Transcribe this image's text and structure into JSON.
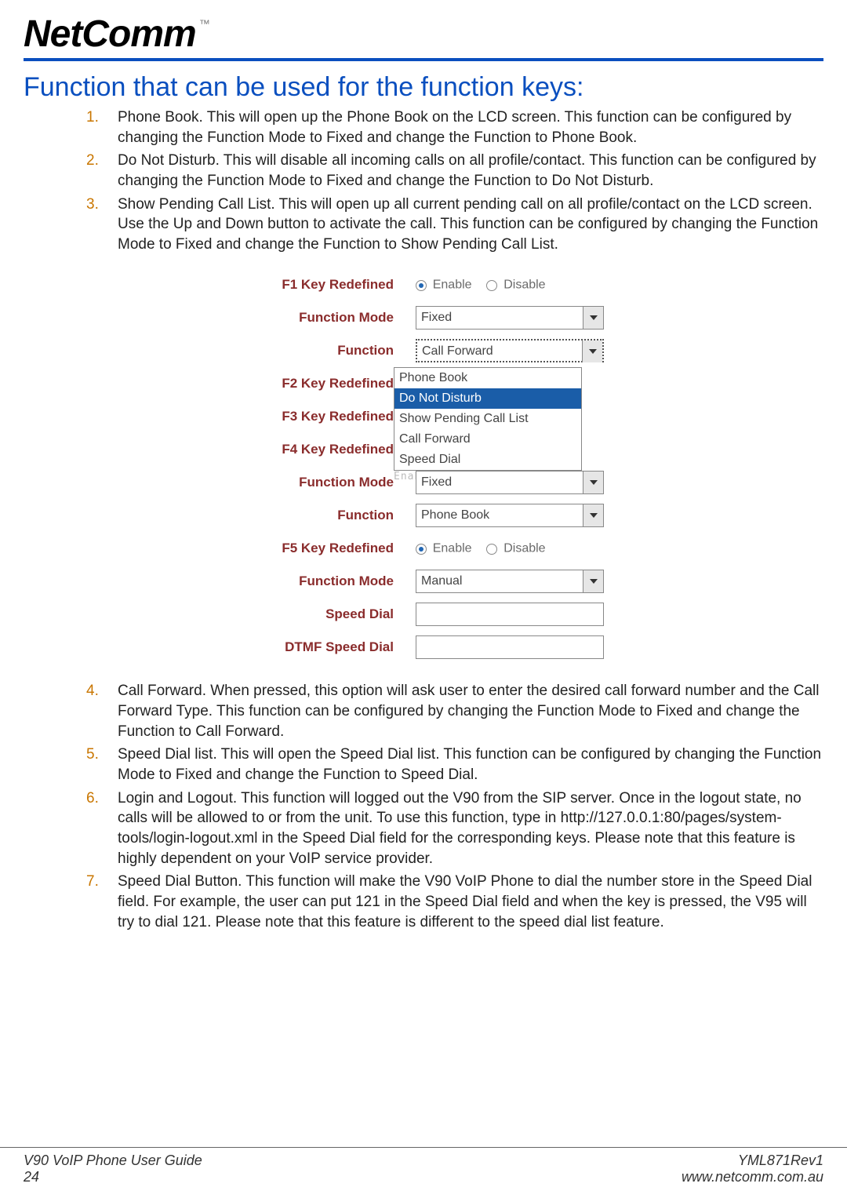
{
  "brand": {
    "name": "NetComm",
    "tm": "™"
  },
  "heading": "Function that can be used for the function keys:",
  "list_top": [
    {
      "n": "1.",
      "text": "Phone Book. This will open up the Phone Book on the LCD screen. This function can be configured by changing the Function Mode to Fixed and change the Function to Phone Book."
    },
    {
      "n": "2.",
      "text": "Do Not Disturb. This will disable all incoming calls on all profile/contact. This function can be configured by changing the Function Mode to Fixed and change the Function to Do Not Disturb."
    },
    {
      "n": "3.",
      "text": "Show Pending Call List. This will open up all current pending call on all profile/contact on the LCD screen. Use the Up and Down button to activate the call. This function can be configured by changing the Function Mode to Fixed and change the Function to Show Pending Call List."
    }
  ],
  "list_bottom": [
    {
      "n": "4.",
      "text": "Call Forward. When pressed, this option will ask user to enter the desired call forward number and the Call Forward Type. This function can be configured by changing the Function Mode to Fixed and change the Function to Call Forward."
    },
    {
      "n": "5.",
      "text": "Speed Dial list. This will open the Speed Dial list. This function can be configured by changing the Function Mode to Fixed and change the Function to Speed Dial."
    },
    {
      "n": "6.",
      "text": "Login and Logout. This function will logged out the V90 from the SIP server. Once in the logout state, no calls will be allowed to or from the unit. To use this function, type in http://127.0.0.1:80/pages/system-tools/login-logout.xml in the Speed Dial field for the corresponding keys. Please note that this feature is highly dependent on your VoIP service provider."
    },
    {
      "n": "7.",
      "text": "Speed Dial Button. This function will make the V90 VoIP Phone to dial the number store in the Speed Dial field. For example, the user can put 121 in the Speed Dial field and when the key is pressed, the V95 will try to dial 121. Please note that this feature is different to the speed dial list feature."
    }
  ],
  "form": {
    "enable": "Enable",
    "disable": "Disable",
    "f1": {
      "label": "F1 Key Redefined",
      "mode_label": "Function Mode",
      "mode_value": "Fixed",
      "func_label": "Function",
      "func_value": "Call Forward"
    },
    "dropdown_options": [
      "Phone Book",
      "Do Not Disturb",
      "Show Pending Call List",
      "Call Forward",
      "Speed Dial"
    ],
    "f2": {
      "label": "F2 Key Redefined"
    },
    "f3": {
      "label": "F3 Key Redefined"
    },
    "f4": {
      "label": "F4 Key Redefined",
      "mode_label": "Function Mode",
      "mode_value": "Fixed",
      "func_label": "Function",
      "func_value": "Phone Book"
    },
    "f5": {
      "label": "F5 Key Redefined",
      "mode_label": "Function Mode",
      "mode_value": "Manual",
      "speed_label": "Speed Dial",
      "dtmf_label": "DTMF Speed Dial"
    },
    "obscured": "Enable   Disable"
  },
  "footer": {
    "guide": "V90 VoIP Phone User Guide",
    "page": "24",
    "rev": "YML871Rev1",
    "url": "www.netcomm.com.au"
  }
}
